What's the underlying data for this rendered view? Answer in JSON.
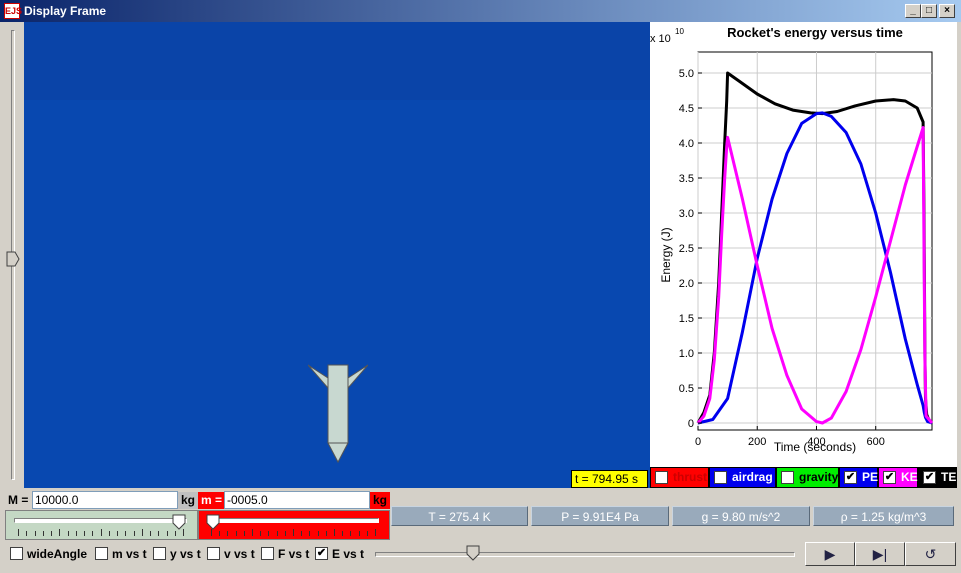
{
  "window": {
    "title": "Display Frame",
    "icon_text": "EJS",
    "controls": {
      "minimize": "_",
      "maximize": "□",
      "close": "×"
    }
  },
  "scene": {
    "sky_color": "#0848b0",
    "rocket_color": "#c8d8d0"
  },
  "time_display": "t = 794.95 s",
  "chart_data": {
    "type": "line",
    "title": "Rocket's energy versus time",
    "xlabel": "Time (seconds)",
    "ylabel": "Energy (J)",
    "y_multiplier": "x 10",
    "y_exponent": "10",
    "xlim": [
      0,
      790
    ],
    "ylim": [
      -0.1,
      5.3
    ],
    "x_ticks": [
      "0",
      "200",
      "400",
      "600"
    ],
    "y_ticks": [
      "0",
      "0.5",
      "1.0",
      "1.5",
      "2.0",
      "2.5",
      "3.0",
      "3.5",
      "4.0",
      "4.5",
      "5.0"
    ],
    "grid": true,
    "series": [
      {
        "name": "TE",
        "color": "#000000",
        "x": [
          0,
          20,
          40,
          55,
          70,
          80,
          90,
          97,
          100,
          140,
          200,
          260,
          320,
          380,
          420,
          470,
          530,
          600,
          660,
          700,
          740,
          760,
          763,
          766,
          768,
          772,
          780,
          790
        ],
        "y": [
          0,
          0.15,
          0.4,
          1.0,
          2.0,
          3.0,
          4.0,
          4.6,
          5.0,
          4.88,
          4.7,
          4.56,
          4.47,
          4.43,
          4.42,
          4.45,
          4.53,
          4.6,
          4.62,
          4.6,
          4.5,
          4.3,
          3.0,
          1.0,
          0.35,
          0.12,
          0.04,
          0
        ]
      },
      {
        "name": "PE",
        "color": "#0000ee",
        "x": [
          0,
          50,
          100,
          150,
          200,
          250,
          300,
          350,
          400,
          420,
          450,
          500,
          550,
          600,
          650,
          700,
          740,
          760,
          764,
          768,
          775,
          790
        ],
        "y": [
          0,
          0.05,
          0.35,
          1.3,
          2.35,
          3.2,
          3.85,
          4.28,
          4.42,
          4.43,
          4.38,
          4.15,
          3.7,
          3.0,
          2.15,
          1.2,
          0.55,
          0.25,
          0.15,
          0.08,
          0.02,
          0
        ]
      },
      {
        "name": "KE",
        "color": "#ff00ff",
        "x": [
          0,
          20,
          40,
          55,
          70,
          80,
          90,
          97,
          100,
          150,
          200,
          250,
          300,
          350,
          400,
          420,
          450,
          500,
          550,
          600,
          650,
          700,
          740,
          760,
          763,
          766,
          770,
          790
        ],
        "y": [
          0,
          0.1,
          0.35,
          0.9,
          1.8,
          2.7,
          3.5,
          3.95,
          4.08,
          3.2,
          2.25,
          1.35,
          0.68,
          0.2,
          0.02,
          0,
          0.07,
          0.45,
          1.05,
          1.8,
          2.6,
          3.4,
          3.95,
          4.22,
          2.5,
          0.9,
          0.1,
          0
        ]
      }
    ]
  },
  "legend": [
    {
      "label": "thrust",
      "checked": false,
      "bg": "#ff0000",
      "fg": "#cc0000"
    },
    {
      "label": "airdrag",
      "checked": false,
      "bg": "#0000ee",
      "fg": "#ffffff"
    },
    {
      "label": "gravity",
      "checked": false,
      "bg": "#00ee00",
      "fg": "#000000"
    },
    {
      "label": "PE",
      "checked": true,
      "bg": "#0000ee",
      "fg": "#ffffff"
    },
    {
      "label": "KE",
      "checked": true,
      "bg": "#ff00ff",
      "fg": "#ffffff"
    },
    {
      "label": "TE",
      "checked": true,
      "bg": "#000000",
      "fg": "#ffffff"
    }
  ],
  "params": {
    "mass": {
      "label": "M =",
      "value": "10000.0",
      "unit": "kg",
      "slider_fraction": 0.97
    },
    "rate": {
      "label": "m =",
      "value": "-0005.0",
      "unit": "kg",
      "slider_fraction": 0.02
    }
  },
  "stats": [
    "T = 275.4 K",
    "P = 9.91E4 Pa",
    "g = 9.80 m/s^2",
    "ρ = 1.25 kg/m^3"
  ],
  "options": [
    {
      "label": "wideAngle",
      "checked": false
    },
    {
      "label": "m vs t",
      "checked": false
    },
    {
      "label": "y vs t",
      "checked": false
    },
    {
      "label": "v vs t",
      "checked": false
    },
    {
      "label": "F vs t",
      "checked": false
    },
    {
      "label": "E vs t",
      "checked": true
    }
  ],
  "playback": {
    "play": "▶",
    "step": "▶|",
    "reset": "↺",
    "time_fraction": 0.22
  },
  "check_mark": "✔"
}
